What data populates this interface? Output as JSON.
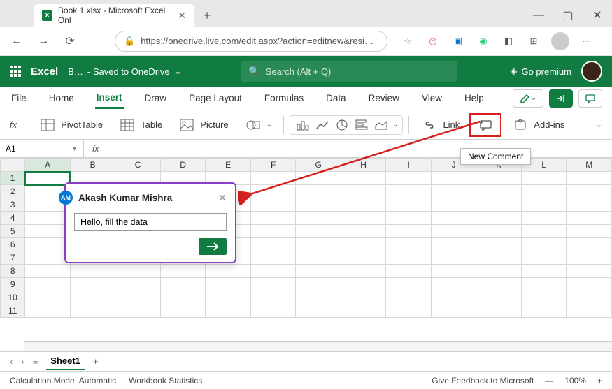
{
  "browser": {
    "tab_title": "Book 1.xlsx - Microsoft Excel Onl",
    "url": "https://onedrive.live.com/edit.aspx?action=editnew&resi…"
  },
  "header": {
    "brand": "Excel",
    "doc_name": "B…",
    "save_status": "- Saved to OneDrive",
    "search_placeholder": "Search (Alt + Q)",
    "premium": "Go premium"
  },
  "ribbon_tabs": [
    "File",
    "Home",
    "Insert",
    "Draw",
    "Page Layout",
    "Formulas",
    "Data",
    "Review",
    "View",
    "Help"
  ],
  "ribbon_active_index": 2,
  "ribbon_items": {
    "pivot": "PivotTable",
    "table": "Table",
    "picture": "Picture",
    "link": "Link",
    "addins": "Add-ins"
  },
  "tooltip": "New Comment",
  "formula_bar": {
    "name_box": "A1"
  },
  "grid": {
    "columns": [
      "A",
      "B",
      "C",
      "D",
      "E",
      "F",
      "G",
      "H",
      "I",
      "J",
      "K",
      "L",
      "M"
    ],
    "rows": [
      1,
      2,
      3,
      4,
      5,
      6,
      7,
      8,
      9,
      10,
      11
    ],
    "selected": "A1"
  },
  "comment": {
    "author": "Akash Kumar Mishra",
    "initials": "AM",
    "text": "Hello, fill the data"
  },
  "sheet": {
    "name": "Sheet1"
  },
  "status": {
    "calc_mode": "Calculation Mode: Automatic",
    "wb_stats": "Workbook Statistics",
    "feedback": "Give Feedback to Microsoft",
    "zoom": "100%"
  }
}
